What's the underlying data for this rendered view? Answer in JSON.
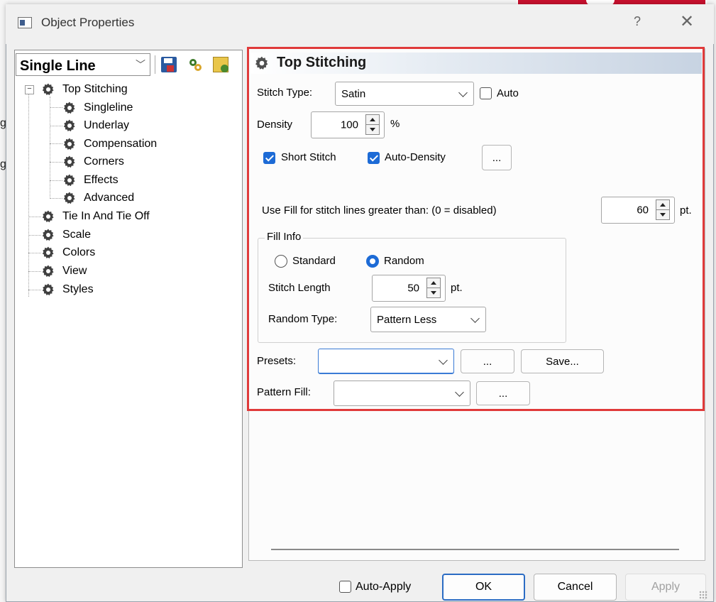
{
  "window": {
    "title": "Object Properties",
    "help_glyph": "?",
    "close_glyph": "✕"
  },
  "background_edge": {
    "glyph1": "g",
    "glyph2": "g"
  },
  "left": {
    "object_type": "Single Line",
    "toolbar_icons": [
      "save-icon",
      "apply-settings-icon",
      "configure-icon"
    ],
    "tree": {
      "root": "Top Stitching",
      "root_children": [
        "Singleline",
        "Underlay",
        "Compensation",
        "Corners",
        "Effects",
        "Advanced"
      ],
      "siblings": [
        "Tie In And Tie Off",
        "Scale",
        "Colors",
        "View",
        "Styles"
      ]
    }
  },
  "section": {
    "title": "Top Stitching"
  },
  "form": {
    "stitch_type_label": "Stitch Type:",
    "stitch_type_value": "Satin",
    "auto_label": "Auto",
    "auto_checked": false,
    "density_label": "Density",
    "density_value": "100",
    "density_unit": "%",
    "short_stitch_label": "Short Stitch",
    "short_stitch_checked": true,
    "auto_density_label": "Auto-Density",
    "auto_density_checked": true,
    "auto_density_more": "...",
    "use_fill_label": "Use Fill for stitch lines greater than: (0 = disabled)",
    "use_fill_value": "60",
    "use_fill_unit": "pt.",
    "fill_info": {
      "group_label": "Fill Info",
      "standard_label": "Standard",
      "random_label": "Random",
      "selected": "Random",
      "stitch_length_label": "Stitch Length",
      "stitch_length_value": "50",
      "stitch_length_unit": "pt.",
      "random_type_label": "Random Type:",
      "random_type_value": "Pattern Less"
    },
    "presets_label": "Presets:",
    "presets_value": "",
    "presets_more": "...",
    "presets_save": "Save...",
    "pattern_fill_label": "Pattern Fill:",
    "pattern_fill_value": "",
    "pattern_fill_more": "..."
  },
  "footer": {
    "auto_apply_label": "Auto-Apply",
    "auto_apply_checked": false,
    "ok": "OK",
    "cancel": "Cancel",
    "apply": "Apply",
    "apply_enabled": false
  },
  "colors": {
    "highlight_frame": "#e03a3a",
    "accent": "#1d6bd6",
    "primary_button_border": "#2b6cc4"
  }
}
